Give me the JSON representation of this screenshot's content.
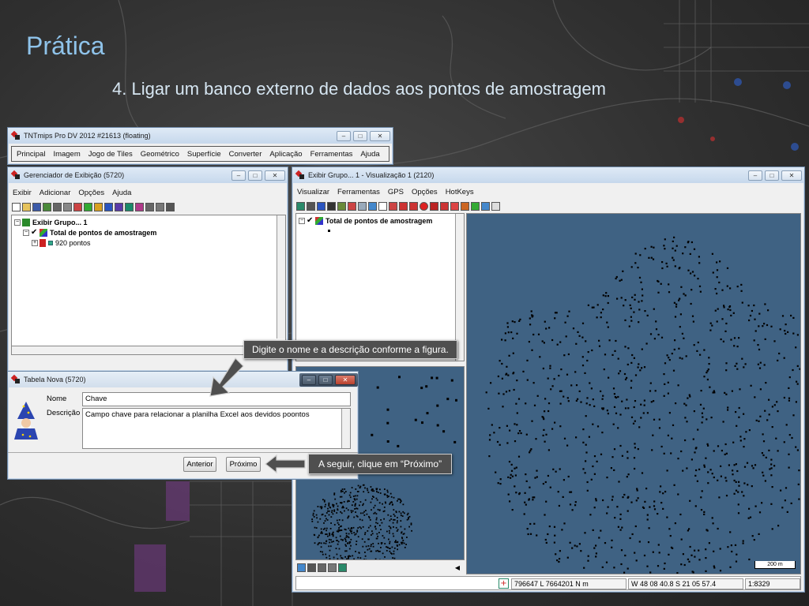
{
  "slide": {
    "title": "Prática",
    "subtitle": "4. Ligar um banco externo de dados aos pontos de amostragem"
  },
  "main_window": {
    "title": "TNTmips Pro DV 2012  #21613 (floating)",
    "menu": [
      "Principal",
      "Imagem",
      "Jogo de Tiles",
      "Geométrico",
      "Superfície",
      "Converter",
      "Aplicação",
      "Ferramentas",
      "Ajuda"
    ]
  },
  "display_manager": {
    "title": "Gerenciador de Exibição (5720)",
    "menu": [
      "Exibir",
      "Adicionar",
      "Opções",
      "Ajuda"
    ],
    "tree": {
      "group": "Exibir Grupo... 1",
      "layer": "Total de pontos de amostragem",
      "points": "920 pontos"
    }
  },
  "view_window": {
    "title": "Exibir Grupo... 1 - Visualização 1 (2120)",
    "menu": [
      "Visualizar",
      "Ferramentas",
      "GPS",
      "Opções",
      "HotKeys"
    ],
    "layer": "Total de pontos de amostragem",
    "scale_bar": "200 m",
    "status": {
      "coords": "796647 L  7664201 N m",
      "latlon": "W 48 08 40.8  S 21 05 57.4",
      "scale": "1:8329"
    },
    "map_color": "#3f6283"
  },
  "new_table": {
    "title": "Tabela Nova (5720)",
    "name_label": "Nome",
    "name_value": "Chave",
    "desc_label": "Descrição",
    "desc_value": "Campo chave para relacionar a planilha Excel aos devidos poontos",
    "back_button": "Anterior",
    "next_button": "Próximo"
  },
  "callouts": {
    "fill_in": "Digite o nome e a descrição conforme a figura.",
    "click_next": "A seguir, clique em “Próximo”"
  }
}
